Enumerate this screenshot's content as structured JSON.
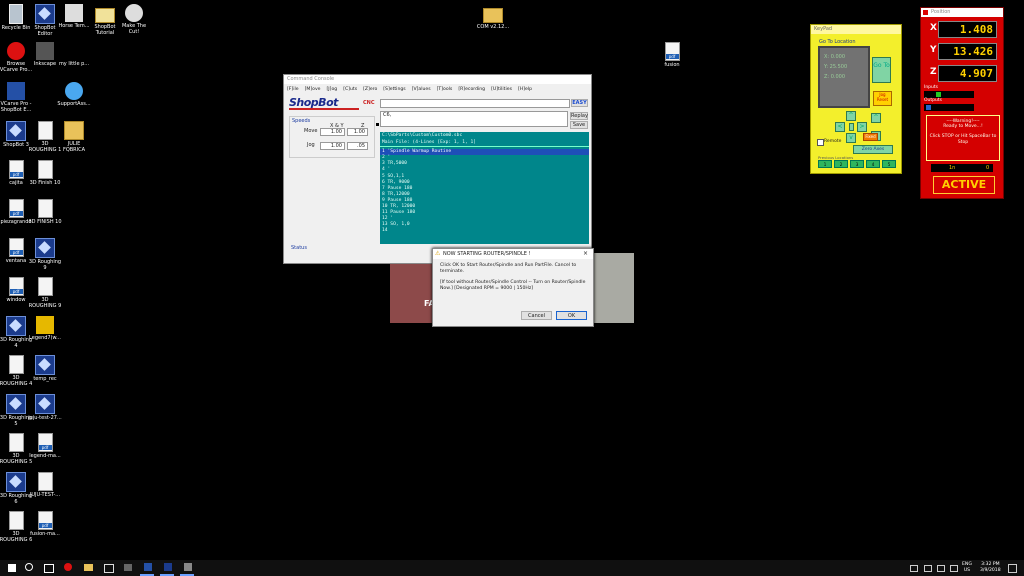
{
  "desktop": {
    "icons": [
      {
        "label": "Recycle Bin",
        "icon": "recycle-bin-icon"
      },
      {
        "label": "ShopBot Editor",
        "icon": "shopbot-icon"
      },
      {
        "label": "Horse Tem...",
        "icon": "image-icon"
      },
      {
        "label": "ShopBot Tutorial",
        "icon": "document-icon"
      },
      {
        "label": "Make The Cut!",
        "icon": "cricut-icon"
      },
      {
        "label": "COM v2.12...",
        "icon": "folder-icon"
      },
      {
        "label": "Browse VCarve Pro...",
        "icon": "opera-icon"
      },
      {
        "label": "Inkscape",
        "icon": "inkscape-icon"
      },
      {
        "label": "my little p...",
        "icon": "document-icon"
      },
      {
        "label": "fusion",
        "icon": "pdf-icon"
      },
      {
        "label": "VCarve Pro - ShopBot E...",
        "icon": "vcarve-icon"
      },
      {
        "label": "SupportAss...",
        "icon": "support-icon"
      },
      {
        "label": "ShopBot 3",
        "icon": "shopbot-icon"
      },
      {
        "label": "3D ROUGHING 1",
        "icon": "document-icon"
      },
      {
        "label": "JULIE FQBRICA",
        "icon": "folder-doc-icon"
      },
      {
        "label": "cajita",
        "icon": "pdf-icon"
      },
      {
        "label": "3D Finish 10",
        "icon": "document-icon"
      },
      {
        "label": "piezagrande",
        "icon": "pdf-icon"
      },
      {
        "label": "3D FINISH 10",
        "icon": "document-icon"
      },
      {
        "label": "ventana",
        "icon": "pdf-icon"
      },
      {
        "label": "3D Roughing 9",
        "icon": "shopbot-icon"
      },
      {
        "label": "window",
        "icon": "pdf-icon"
      },
      {
        "label": "3D ROUGHING 9",
        "icon": "document-icon"
      },
      {
        "label": "3D Roughing 4",
        "icon": "shopbot-icon"
      },
      {
        "label": "Legend7(w...",
        "icon": "app-icon"
      },
      {
        "label": "3D ROUGHING 4",
        "icon": "document-icon"
      },
      {
        "label": "temp_rec",
        "icon": "shopbot-icon"
      },
      {
        "label": "3D Roughing 5",
        "icon": "shopbot-icon"
      },
      {
        "label": "juju-test-27...",
        "icon": "shopbot-icon"
      },
      {
        "label": "3D ROUGHING 5",
        "icon": "document-icon"
      },
      {
        "label": "legend-ma...",
        "icon": "pdf-icon"
      },
      {
        "label": "3D Roughing 6",
        "icon": "shopbot-icon"
      },
      {
        "label": "JUJU-TEST-...",
        "icon": "document-icon"
      },
      {
        "label": "3D ROUGHING 6",
        "icon": "document-icon"
      },
      {
        "label": "fusion-ma...",
        "icon": "pdf-icon"
      }
    ]
  },
  "console": {
    "title": "Command Console",
    "menu": [
      "[F]ile",
      "[M]ove",
      "[J]og",
      "[C]uts",
      "[Z]ero",
      "[S]ettings",
      "[V]alues",
      "[T]ools",
      "[R]ecording",
      "[U]tilities",
      "[H]elp"
    ],
    "logo": "ShopBot",
    "logo_sub": "CNC",
    "easy_label": "EASY",
    "cmd_value": "",
    "cmd2_value": "C6,",
    "replay_label": "Replay",
    "save_label": "Save",
    "speeds_label": "Speeds",
    "xy_header": "X & Y",
    "z_header": "Z",
    "move_label": "Move",
    "move_xy": "1.00",
    "move_z": "1.00",
    "jog_label": "Jog",
    "jog_xy": "1.00",
    "jog_z": ".05",
    "status_label": "Status",
    "file_path": "C:\\SbParts\\Custom\\Custom0.sbc",
    "main_file": "Main File:  (4-Lines [Exp: 1, 1, 1]",
    "lines": [
      "1  'Spindle Warmup Routine",
      "2  '",
      "3  TR,5000",
      "4  '",
      "5  SO,1,1",
      "6  TR, 9000",
      "7  Pause 180",
      "8  TR,12000",
      "9  Pause 180",
      "10 TR, 12000",
      "11 Pause 180",
      "12 '",
      "13 SO, 1,0",
      "14"
    ]
  },
  "keypad": {
    "title": "KeyPad",
    "section": "Go To Location",
    "readouts": [
      "X: 0.000",
      "Y: 25.500",
      "Z: 0.000"
    ],
    "goto_label": "Go To",
    "jog_reset_label": "Jog Reset",
    "fixed_label": "Fixed",
    "remote_label": "Remote",
    "zero_axes_label": "Zero Axes",
    "prev_locations_label": "Previous Locations",
    "loc_buttons": [
      "1",
      "2",
      "3",
      "4",
      "5"
    ]
  },
  "position": {
    "title": "Position",
    "x_label": "X",
    "x_value": "1.408",
    "y_label": "Y",
    "y_value": "13.426",
    "z_label": "Z",
    "z_value": "4.907",
    "inputs_label": "Inputs",
    "outputs_label": "Outputs",
    "warning_title": "----Warning!----",
    "warning_line1": "Ready to Move...!",
    "warning_line2": "Click STOP or Hit SpaceBar to Stop",
    "unit_value": "1n",
    "unit_count": "0",
    "active_label": "ACTIVE"
  },
  "dialog": {
    "title": "NOW STARTING ROUTER/SPINDLE !",
    "line1": "Click OK to Start Router/Spindle and Run PartFile. Cancel to terminate.",
    "line2": "[If tool without Router/Spindle Control -- Turn on Router/Spindle Now.]  [Designated RPM = 9000 | 150Hz]",
    "cancel_label": "Cancel",
    "ok_label": "OK"
  },
  "background_image_text": "FA",
  "taskbar": {
    "time": "3:32 PM",
    "date": "3/9/2018",
    "lang": "ENG",
    "region": "US"
  }
}
